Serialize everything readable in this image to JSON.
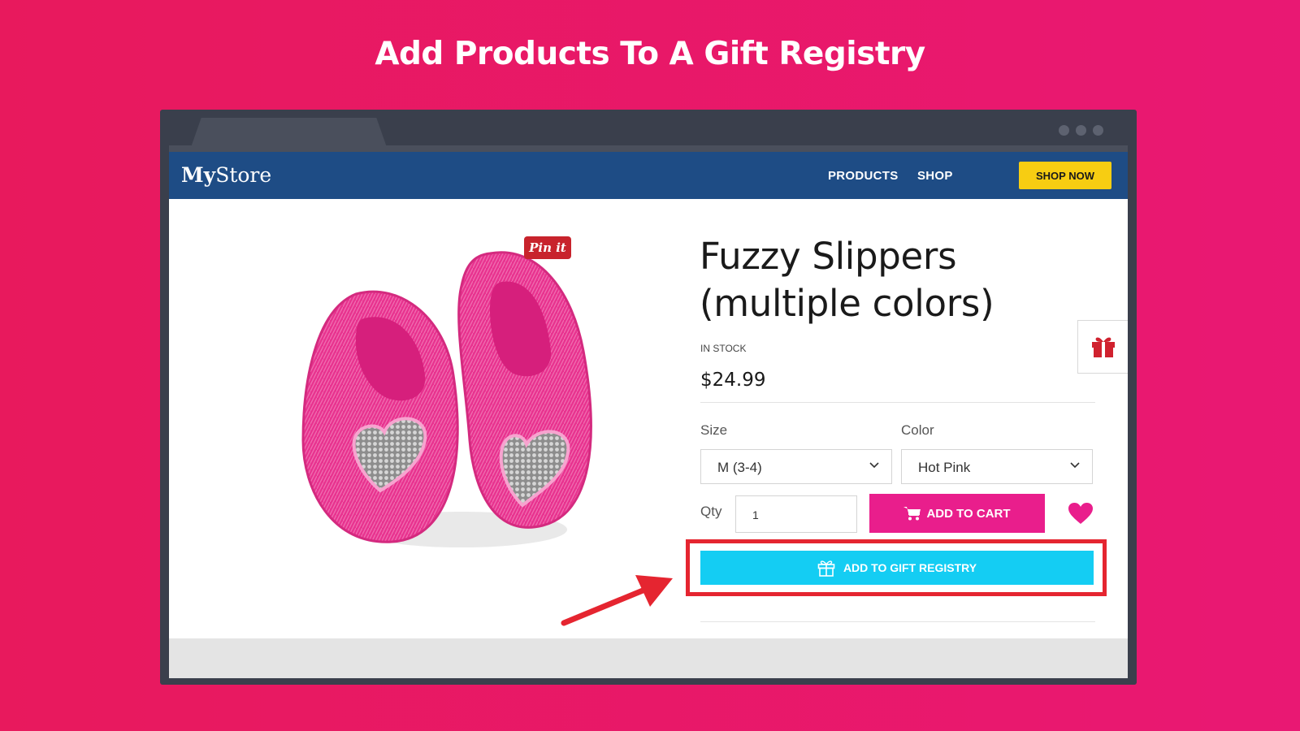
{
  "headline": "Add Products To A Gift Registry",
  "colors": {
    "background": "#e8195d",
    "navbar": "#1e4c85",
    "shop_now": "#f7cd12",
    "add_to_cart": "#e91e8c",
    "gift_registry": "#14cdf3",
    "highlight": "#e52530"
  },
  "store": {
    "logo_bold": "My",
    "logo_rest": "Store",
    "nav": [
      "PRODUCTS",
      "SHOP"
    ],
    "cta": "SHOP NOW"
  },
  "product": {
    "pin_label": "Pin it",
    "title": "Fuzzy Slippers (multiple colors)",
    "stock": "IN STOCK",
    "price": "$24.99",
    "size_label": "Size",
    "size_value": "M (3-4)",
    "color_label": "Color",
    "color_value": "Hot Pink",
    "qty_label": "Qty",
    "qty_value": "1",
    "add_to_cart": "ADD TO CART",
    "add_to_registry": "ADD TO GIFT REGISTRY"
  },
  "icons": [
    "cart-icon",
    "heart-icon",
    "gift-icon",
    "chevron-down-icon",
    "red-arrow"
  ]
}
